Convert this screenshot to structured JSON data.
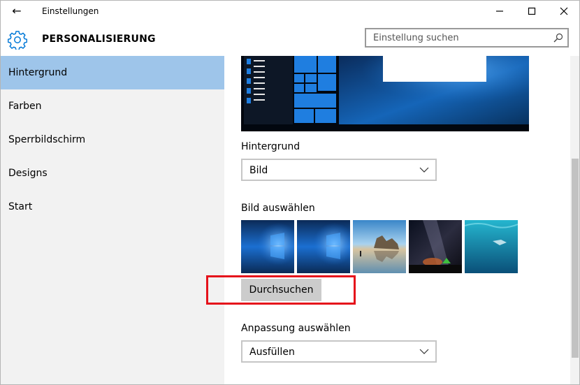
{
  "window": {
    "title": "Einstellungen",
    "back_glyph": "←",
    "minimize_glyph": "—",
    "maximize_glyph": "☐",
    "close_glyph": "✕"
  },
  "header": {
    "title": "PERSONALISIERUNG",
    "icon": "gear-icon",
    "accent_color": "#0078d7"
  },
  "search": {
    "placeholder": "Einstellung suchen",
    "value": ""
  },
  "sidebar": {
    "active_color": "#9ec5ea",
    "items": [
      {
        "label": "Hintergrund",
        "active": true
      },
      {
        "label": "Farben",
        "active": false
      },
      {
        "label": "Sperrbildschirm",
        "active": false
      },
      {
        "label": "Designs",
        "active": false
      },
      {
        "label": "Start",
        "active": false
      }
    ]
  },
  "main": {
    "background_label": "Hintergrund",
    "background_select": {
      "value": "Bild"
    },
    "choose_picture_label": "Bild auswählen",
    "thumbnails": [
      {
        "name": "Windows 10 Hero (blau)"
      },
      {
        "name": "Windows 10 Hero (blau)"
      },
      {
        "name": "Strand mit Felsen"
      },
      {
        "name": "Milchstraße"
      },
      {
        "name": "Unterwasser"
      }
    ],
    "browse_button": "Durchsuchen",
    "fit_label": "Anpassung auswählen",
    "fit_select": {
      "value": "Ausfüllen"
    }
  },
  "highlight": {
    "color": "#e5121b"
  }
}
